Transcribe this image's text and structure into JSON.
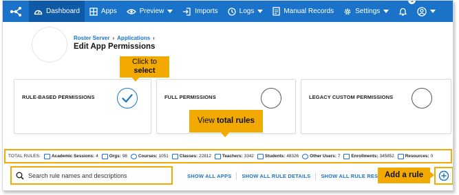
{
  "nav": {
    "items": [
      {
        "label": "Dashboard",
        "icon": "dashboard-icon",
        "active": true
      },
      {
        "label": "Apps",
        "icon": "apps-grid-icon"
      },
      {
        "label": "Preview",
        "icon": "eye-icon",
        "dropdown": true
      },
      {
        "label": "Imports",
        "icon": "import-icon"
      },
      {
        "label": "Logs",
        "icon": "clock-icon",
        "dropdown": true
      },
      {
        "label": "Manual Records",
        "icon": "document-icon"
      },
      {
        "label": "Settings",
        "icon": "gear-icon",
        "dropdown": true
      }
    ],
    "notification_count": "1",
    "colors": {
      "bar": "#1a73c8",
      "active": "#0f5aa6"
    }
  },
  "header": {
    "breadcrumb": [
      "Roster Server",
      "Applications"
    ],
    "title": "Edit App Permissions"
  },
  "callouts": {
    "select_line1": "Click to",
    "select_line2": "select",
    "total_prefix": "View",
    "total_bold": "total rules",
    "add": "Add a rule",
    "color": "#f2a900"
  },
  "cards": [
    {
      "label": "RULE-BASED PERMISSIONS",
      "selected": true
    },
    {
      "label": "FULL PERMISSIONS",
      "selected": false
    },
    {
      "label": "LEGACY CUSTOM PERMISSIONS",
      "selected": false
    }
  ],
  "totals": {
    "label": "TOTAL RULES:",
    "stats": [
      {
        "name": "Academic Sessions:",
        "value": "4"
      },
      {
        "name": "Orgs:",
        "value": "98"
      },
      {
        "name": "Courses:",
        "value": "1051"
      },
      {
        "name": "Classes:",
        "value": "22812"
      },
      {
        "name": "Teachers:",
        "value": "3342"
      },
      {
        "name": "Students:",
        "value": "48326"
      },
      {
        "name": "Other Users:",
        "value": "7"
      },
      {
        "name": "Enrollments:",
        "value": "345852"
      },
      {
        "name": "Resources:",
        "value": "0"
      }
    ]
  },
  "search": {
    "placeholder": "Search rule names and descriptions"
  },
  "links": {
    "show_all_apps": "SHOW ALL APPS",
    "show_all_rule_details": "SHOW ALL RULE DETAILS",
    "show_all_rule_results": "SHOW ALL RULE RESULTS"
  }
}
